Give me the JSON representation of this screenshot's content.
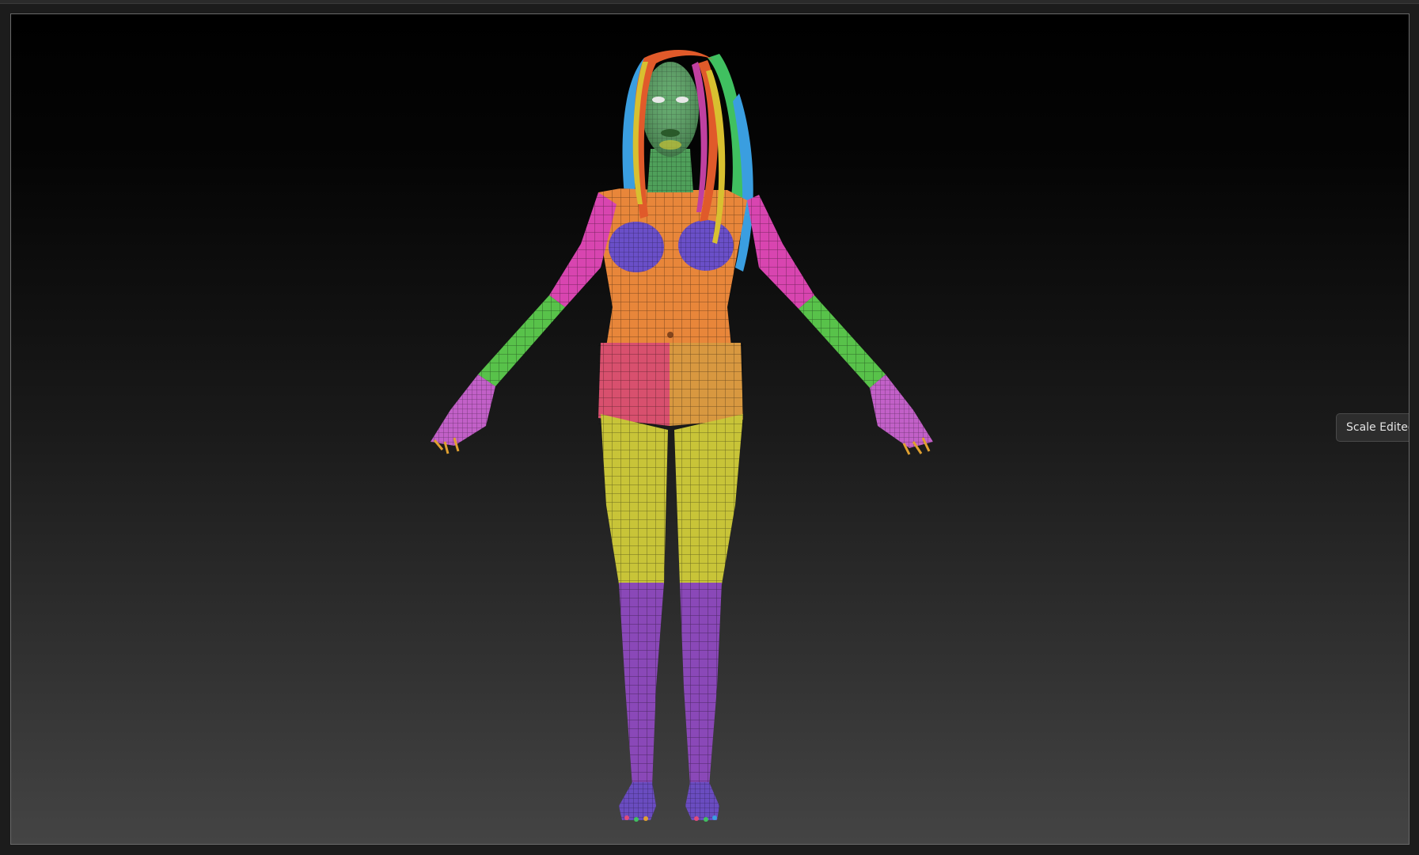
{
  "tooltip": {
    "text": "Scale Edited Objec"
  },
  "viewport": {
    "background_top": "#000000",
    "background_bottom": "#444444",
    "frame_color": "#6a6a6a"
  },
  "model": {
    "icon": "polygroup-mesh-figure",
    "polygroup_colors": {
      "head": "#4fa05a",
      "torso": "#e8863a",
      "breasts": "#6a4fc8",
      "upper_arms": "#d845b0",
      "forearms": "#58c24a",
      "hands": "#c260c8",
      "hips_left": "#d8506e",
      "hips_right": "#d89840",
      "thighs": "#c8c438",
      "shins": "#8a48b8",
      "feet": "#6a4cc0",
      "hair": [
        "#e05a2a",
        "#3a9ee0",
        "#40c060",
        "#d8c030",
        "#c040a0"
      ]
    }
  }
}
